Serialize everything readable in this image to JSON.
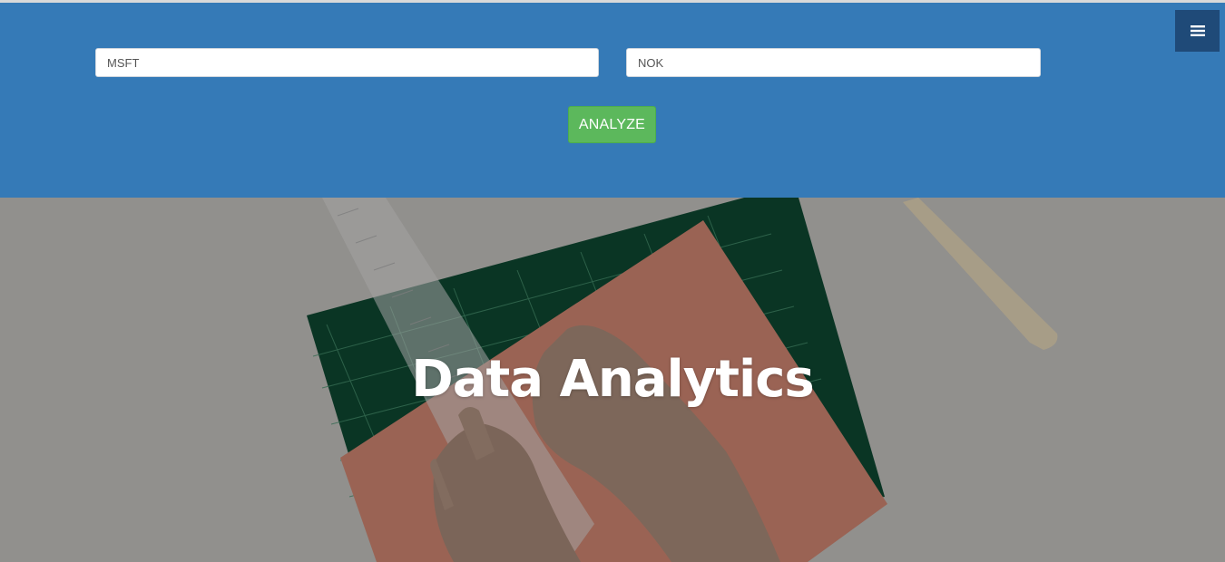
{
  "form": {
    "ticker_1": {
      "value": "MSFT"
    },
    "ticker_2": {
      "value": "NOK"
    },
    "analyze_label": "ANALYZE"
  },
  "nav": {
    "menu_icon": "hamburger-menu-icon"
  },
  "hero": {
    "title": "Data Analytics",
    "image": "hands-measuring-paper-with-ruler-on-cutting-mat"
  },
  "colors": {
    "header_bg": "#357ab7",
    "menu_bg": "#1f4a78",
    "button_bg": "#5cb85c",
    "hero_title": "#ffffff"
  }
}
